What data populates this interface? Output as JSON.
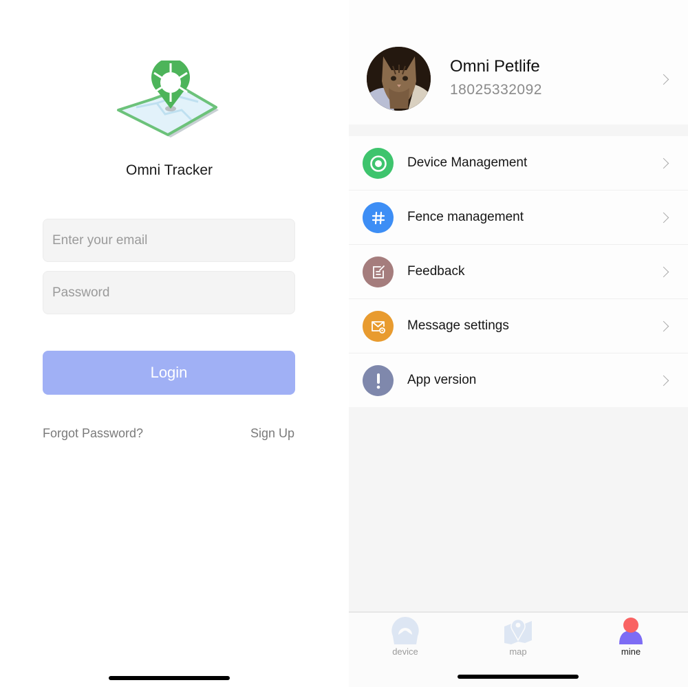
{
  "login": {
    "app_title": "Omni Tracker",
    "email_placeholder": "Enter your email",
    "email_value": "",
    "password_placeholder": "Password",
    "password_value": "",
    "login_label": "Login",
    "forgot_label": "Forgot Password?",
    "signup_label": "Sign Up",
    "login_button_color": "#a0b0f5",
    "logo_icon": "map-pin-logo-icon"
  },
  "profile": {
    "user_name": "Omni Petlife",
    "user_phone": "18025332092",
    "avatar": "cat-photo-avatar",
    "menu": [
      {
        "label": "Device Management",
        "icon": "target-icon",
        "color": "#3ec46d"
      },
      {
        "label": "Fence management",
        "icon": "hash-icon",
        "color": "#3d8ef5"
      },
      {
        "label": "Feedback",
        "icon": "edit-note-icon",
        "color": "#a57d7d"
      },
      {
        "label": "Message settings",
        "icon": "mail-settings-icon",
        "color": "#e89b2f"
      },
      {
        "label": "App version",
        "icon": "exclamation-icon",
        "color": "#7f88ac"
      }
    ],
    "tabs": [
      {
        "label": "device",
        "icon": "device-icon",
        "active": false
      },
      {
        "label": "map",
        "icon": "map-icon",
        "active": false
      },
      {
        "label": "mine",
        "icon": "person-icon",
        "active": true
      }
    ]
  }
}
